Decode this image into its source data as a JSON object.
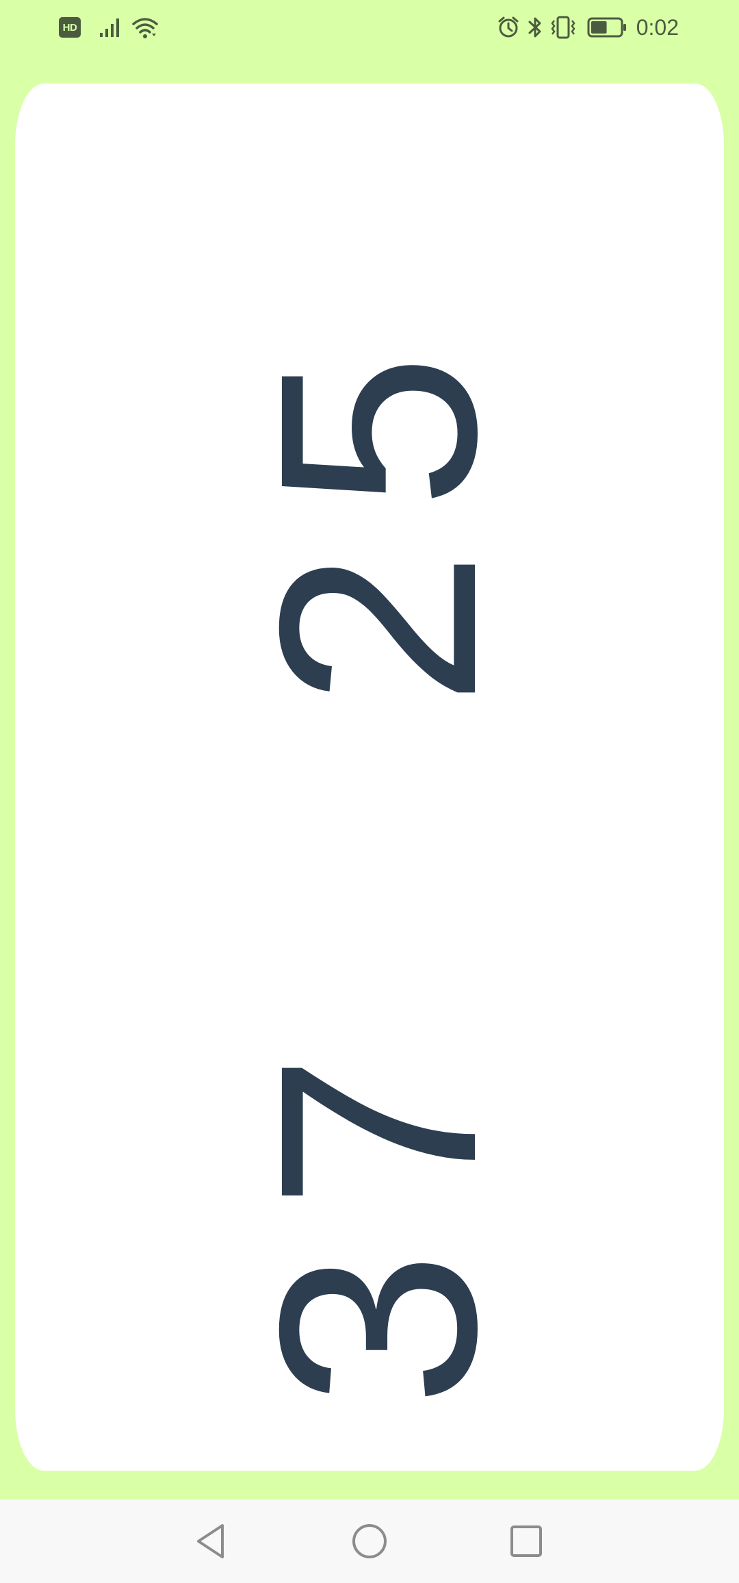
{
  "status_bar": {
    "hd_label": "HD",
    "time": "0:02",
    "icons": [
      "hd-icon",
      "signal-icon",
      "wifi-icon",
      "alarm-icon",
      "bluetooth-icon",
      "vibrate-icon",
      "battery-icon"
    ],
    "battery_level": 0.55
  },
  "scores": {
    "top": "25",
    "bottom": "37"
  },
  "colors": {
    "background": "#d9ffa7",
    "card": "#ffffff",
    "score_text": "#2d3e50",
    "status_text": "#4b5b3f",
    "nav_bar": "#f8f8f8",
    "nav_icon": "#8c8c8c"
  },
  "nav_bar": {
    "buttons": [
      "back-icon",
      "home-icon",
      "recents-icon"
    ]
  }
}
